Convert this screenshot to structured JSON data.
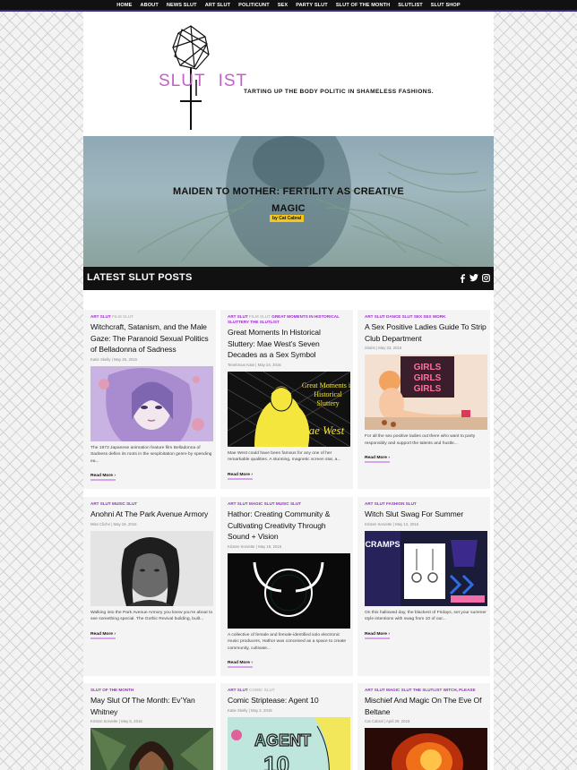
{
  "nav": [
    "HOME",
    "ABOUT",
    "NEWS SLUT",
    "ART SLUT",
    "POLITICUNT",
    "SEX",
    "PARTY SLUT",
    "SLUT OF THE MONTH",
    "SLUTLIST",
    "SLUT SHOP"
  ],
  "header": {
    "logo_text": "SLUT",
    "logo_text2": "IST",
    "tagline": "TARTING UP THE BODY POLITIC IN SHAMELESS FASHIONS."
  },
  "hero": {
    "title_line1": "MAIDEN TO MOTHER: FERTILITY AS CREATIVE",
    "title_line2": "MAGIC",
    "byline": "by Cat Cabral"
  },
  "latest": {
    "title": "LATEST SLUT POSTS",
    "icons": [
      "facebook-icon",
      "twitter-icon",
      "instagram-icon"
    ]
  },
  "read_more": "Read More ›",
  "posts": [
    {
      "cats": [
        [
          "ART SLUT",
          "p"
        ],
        [
          "FILM SLUT",
          "g"
        ]
      ],
      "title": "Witchcraft, Satanism, and the Male Gaze: The Paranoid Sexual Politics of Belladonna of Sadness",
      "author": "Katie Skelly",
      "date": "May 26, 2016",
      "excerpt": "The 1973 Japanese animation feature film Belladonna of Sadness defies its roots in the sexploitation genre by spending ea..."
    },
    {
      "cats": [
        [
          "ART SLUT",
          "p"
        ],
        [
          "FILM SLUT",
          "g"
        ],
        [
          "GREAT MOMENTS IN HISTORICAL SLUTTERY",
          "p"
        ],
        [
          "THE SLUTLIST",
          "p"
        ]
      ],
      "title": "Great Moments In Historical Sluttery: Mae West’s Seven Decades as a Sex Symbol",
      "author": "Tenebrous Kate",
      "date": "May 24, 2016",
      "excerpt": "Mae West could have been famous for any one of her remarkable qualities. A stunning, magnetic screen star, a...",
      "thumb_text": "Great Moments in Historical Sluttery",
      "thumb_text2": "Mae West"
    },
    {
      "cats": [
        [
          "ART SLUT",
          "p"
        ],
        [
          "DANCE SLUT",
          "p"
        ],
        [
          "SEX",
          "p"
        ],
        [
          "SEX WORK",
          "p"
        ]
      ],
      "title": "A Sex Positive Ladies Guide To Strip Club Department",
      "author": "Slutist",
      "date": "May 23, 2016",
      "excerpt": "For all the sex positive ladies out there who want to party responsibly and support the talents and hustle...",
      "thumb_text": "GIRLS GIRLS GIRLS"
    },
    {
      "cats": [
        [
          "ART SLUT",
          "p"
        ],
        [
          "MUSIC SLUT",
          "p"
        ]
      ],
      "title": "Anohni At The Park Avenue Armory",
      "author": "Miss Cliche",
      "date": "May 19, 2016",
      "excerpt": "Walking into the Park Avenue Armory you knew you’re about to see something special. The Gothic Revival building, built..."
    },
    {
      "cats": [
        [
          "ART SLUT",
          "p"
        ],
        [
          "MAGIC SLUT",
          "p"
        ],
        [
          "MUSIC SLUT",
          "p"
        ]
      ],
      "title": "Hathor: Creating Community & Cultivating Creativity Through Sound + Vision",
      "author": "Kristen Korvette",
      "date": "May 18, 2016",
      "excerpt": "A collective of female and female-identified solo electronic music producers, Hathor was conceived as a space to create community, cultivate..."
    },
    {
      "cats": [
        [
          "ART SLUT",
          "p"
        ],
        [
          "FASHION SLUT",
          "p"
        ]
      ],
      "title": "Witch Slut Swag For Summer",
      "author": "Kristen Korvette",
      "date": "May 13, 2016",
      "excerpt": "On this hallowed day, the blackest of Fridays, set your summer style intentions with swag from 10 of our...",
      "thumb_text": "CRAMPS"
    },
    {
      "cats": [
        [
          "SLUT OF THE MONTH",
          "p"
        ]
      ],
      "title": "May Slut Of The Month: Ev’Yan Whitney",
      "author": "Kristen Korvette",
      "date": "May 5, 2016"
    },
    {
      "cats": [
        [
          "ART SLUT",
          "p"
        ],
        [
          "COMIC SLUT",
          "g"
        ]
      ],
      "title": "Comic Striptease: Agent 10",
      "author": "Katie Skelly",
      "date": "May 2, 2016",
      "thumb_text": "AGENT 10"
    },
    {
      "cats": [
        [
          "ART SLUT",
          "p"
        ],
        [
          "MAGIC SLUT",
          "p"
        ],
        [
          "THE SLUTLIST",
          "p"
        ],
        [
          "WITCH, PLEASE",
          "p"
        ]
      ],
      "title": "Mischief And Magic On The Eve Of Beltane",
      "author": "Cat Cabral",
      "date": "April 29, 2016"
    }
  ]
}
